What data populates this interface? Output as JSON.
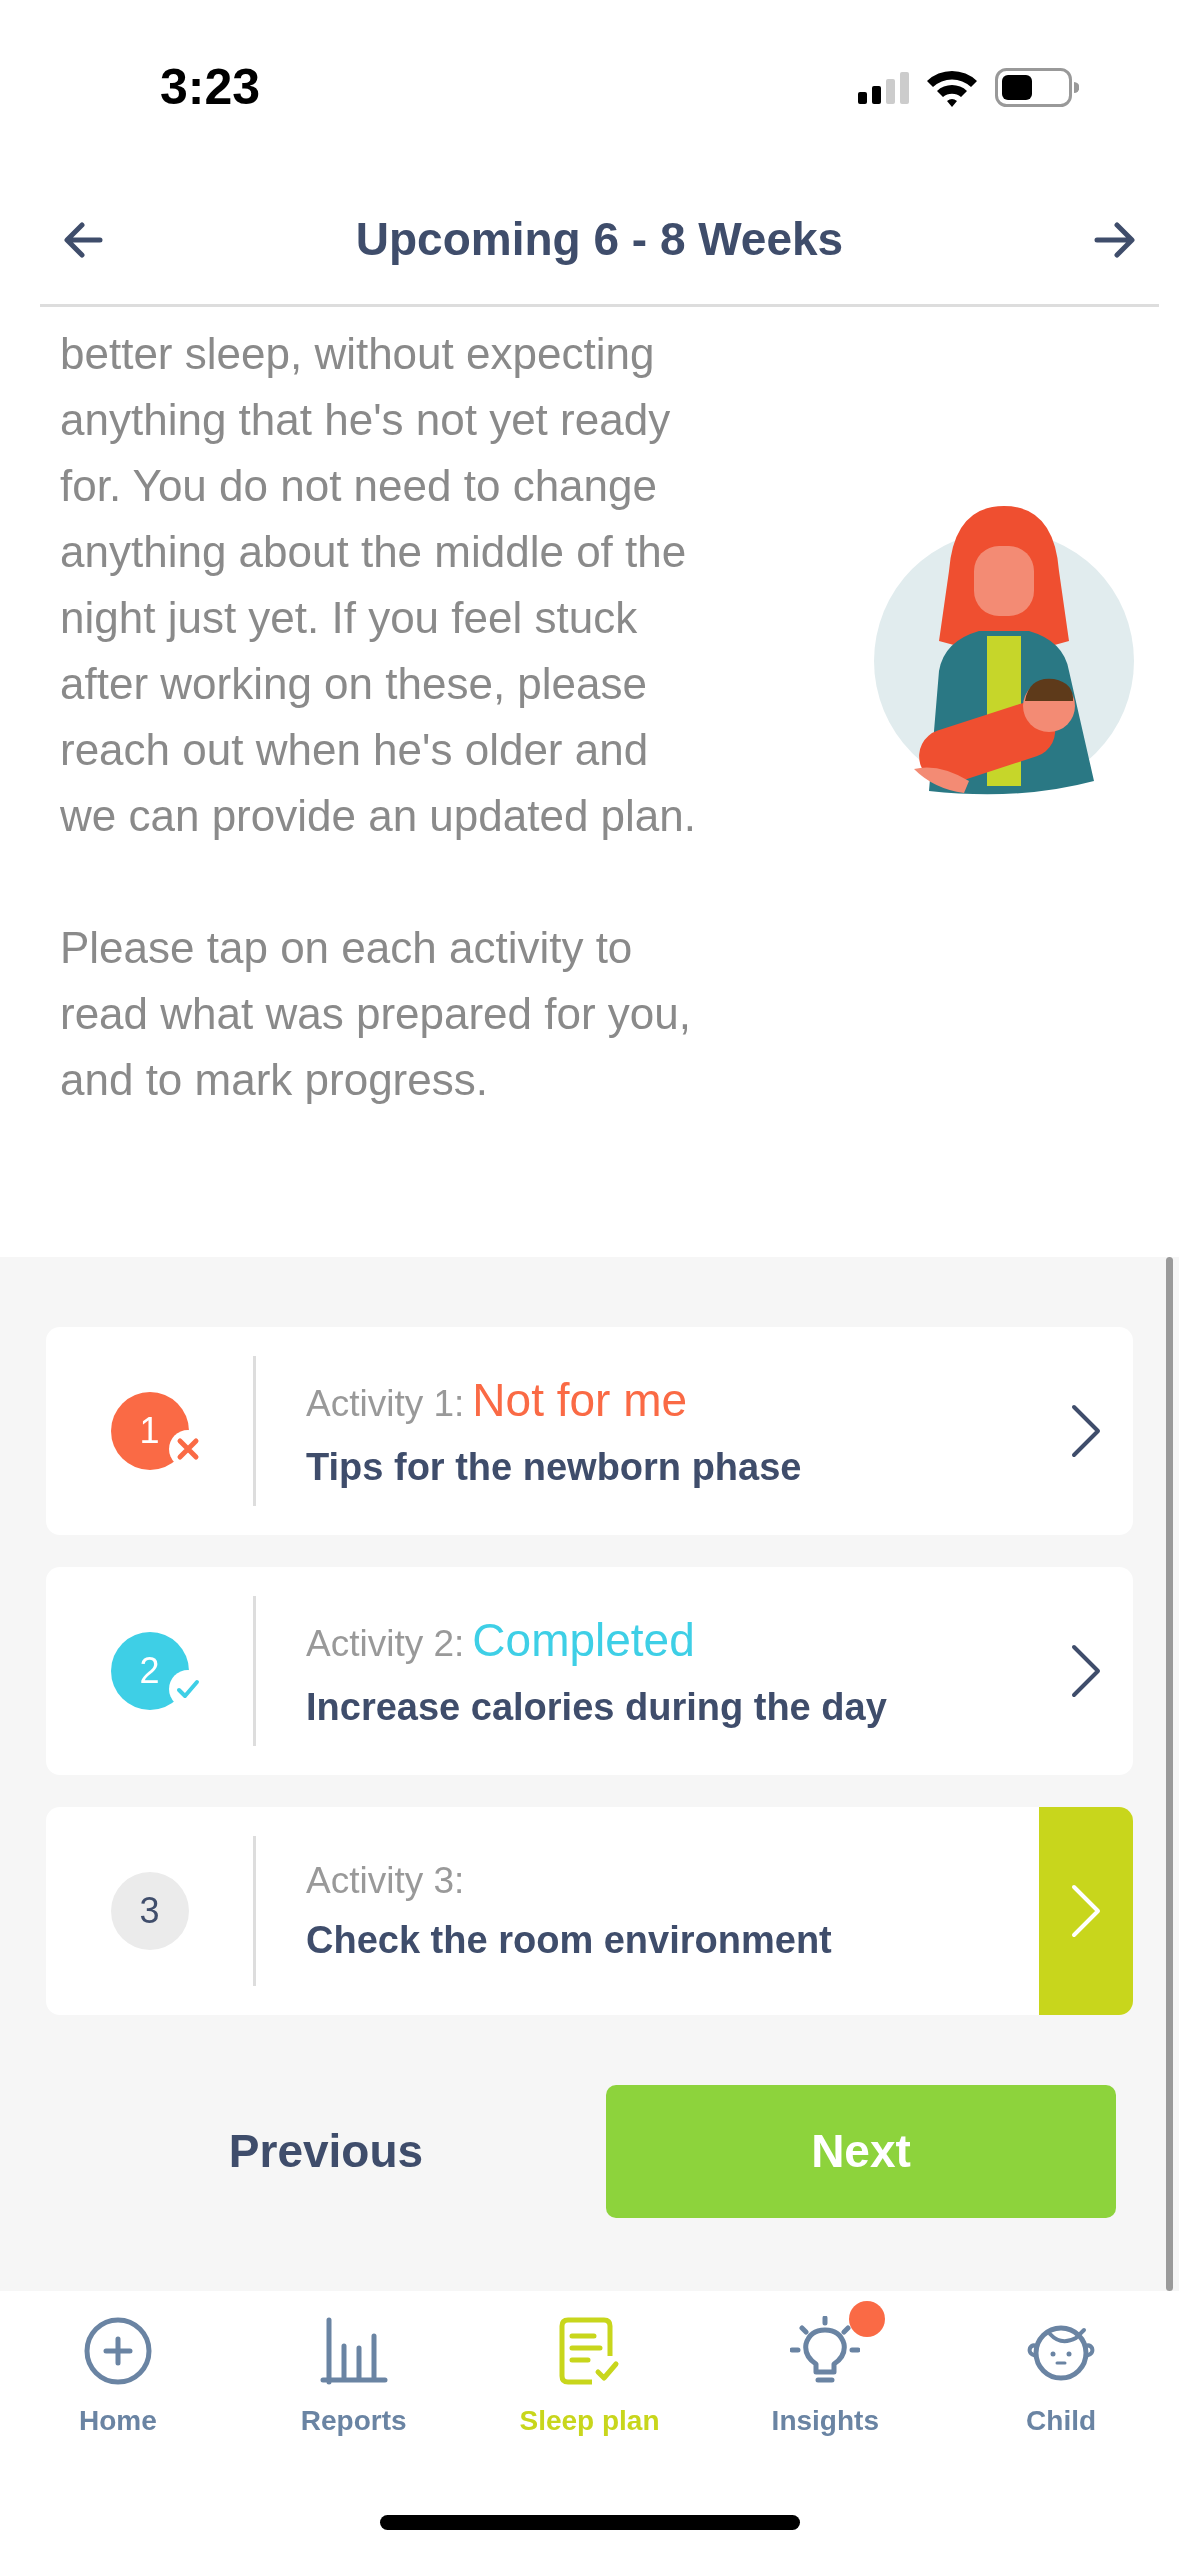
{
  "status_bar": {
    "time": "3:23"
  },
  "header": {
    "title": "Upcoming 6 - 8 Weeks"
  },
  "intro": {
    "paragraphs": [
      "better sleep, without expecting anything that he's not yet ready for. You do not need to change anything about the middle of the night just yet. If you feel stuck after working on these, please reach out when he's older and we can provide an updated plan.",
      "Please tap on each activity to read what was prepared for you, and to mark progress."
    ],
    "illustration": {
      "kind": "picture"
    }
  },
  "activities": [
    {
      "number": "1",
      "label": "Activity 1:",
      "status_text": "Not for me",
      "kind": "not_for_me",
      "title": "Tips for the newborn phase",
      "selected": false
    },
    {
      "number": "2",
      "label": "Activity 2:",
      "status_text": "Completed",
      "kind": "completed",
      "title": "Increase calories during the day",
      "selected": false
    },
    {
      "number": "3",
      "label": "Activity 3:",
      "kind": "pending",
      "title": "Check the room environment",
      "selected": true
    }
  ],
  "buttons": {
    "previous": "Previous",
    "next": "Next"
  },
  "tab_bar": [
    {
      "label": "Home",
      "kind": "home",
      "selected": false,
      "notification": false
    },
    {
      "label": "Reports",
      "kind": "reports",
      "selected": false,
      "notification": false
    },
    {
      "label": "Sleep plan",
      "kind": "plan",
      "selected": true,
      "notification": false
    },
    {
      "label": "Insights",
      "kind": "insights",
      "selected": false,
      "notification": true
    },
    {
      "label": "Child",
      "kind": "child",
      "selected": false,
      "notification": false
    }
  ]
}
